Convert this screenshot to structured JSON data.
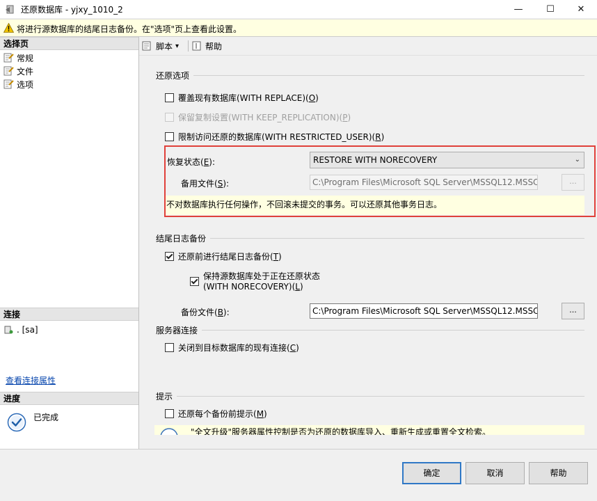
{
  "window": {
    "title": "还原数据库 - yjxy_1010_2",
    "minimize": "—",
    "maximize": "☐",
    "close": "✕"
  },
  "warning": {
    "icon": "warning-icon",
    "text": "将进行源数据库的结尾日志备份。在\"选项\"页上查看此设置。"
  },
  "left": {
    "select_page_header": "选择页",
    "pages": [
      {
        "label": "常规",
        "icon": "page-icon"
      },
      {
        "label": "文件",
        "icon": "page-icon"
      },
      {
        "label": "选项",
        "icon": "page-icon"
      }
    ],
    "connection_header": "连接",
    "connection_value": ". [sa]",
    "view_connection_props": "查看连接属性",
    "progress_header": "进度",
    "progress_status": "已完成"
  },
  "toolbar": {
    "script_label": "脚本",
    "dropdown_glyph": "▾",
    "help_label": "帮助"
  },
  "restore_options": {
    "section": "还原选项",
    "overwrite": {
      "label": "覆盖现有数据库(WITH REPLACE)(",
      "key": "O",
      "checked": false
    },
    "keep_replication": {
      "label": "保留复制设置(WITH KEEP_REPLICATION)(",
      "key": "P",
      "checked": false
    },
    "restricted_user": {
      "label": "限制访问还原的数据库(WITH RESTRICTED_USER)(",
      "key": "R",
      "checked": false
    },
    "recovery_state_label": "恢复状态(",
    "recovery_state_key": "E",
    "recovery_state_value": "RESTORE WITH NORECOVERY",
    "standby_file_label": "备用文件(",
    "standby_file_key": "S",
    "standby_file_value": "C:\\Program Files\\Microsoft SQL Server\\MSSQL12.MSSC",
    "standby_browse": "...",
    "recovery_hint": "不对数据库执行任何操作，不回滚未提交的事务。可以还原其他事务日志。"
  },
  "tail_log": {
    "section": "结尾日志备份",
    "take_tail_backup": {
      "label": "还原前进行结尾日志备份(",
      "key": "T",
      "checked": true
    },
    "leave_restoring_line1": "保持源数据库处于正在还原状态",
    "leave_restoring_line2": "(WITH NORECOVERY)(",
    "leave_restoring_key": "L",
    "leave_restoring_checked": true,
    "backup_file_label": "备份文件(",
    "backup_file_key": "B",
    "backup_file_value": "C:\\Program Files\\Microsoft SQL Server\\MSSQL12.MSSC",
    "backup_browse": "..."
  },
  "server_connections": {
    "section": "服务器连接",
    "close_existing": {
      "label": "关闭到目标数据库的现有连接(",
      "key": "C",
      "checked": false
    }
  },
  "prompt": {
    "section": "提示",
    "prompt_before_each": {
      "label": "还原每个备份前提示(",
      "key": "M",
      "checked": false
    },
    "info_text": "\"全文升级\"服务器属性控制是否为还原的数据库导入、重新生成或重置全文检索。"
  },
  "buttons": {
    "ok": "确定",
    "cancel": "取消",
    "help": "帮助"
  },
  "colors": {
    "highlight_border": "#e0403a",
    "info_background": "#ffffe1",
    "default_button_border": "#2f78c6"
  }
}
